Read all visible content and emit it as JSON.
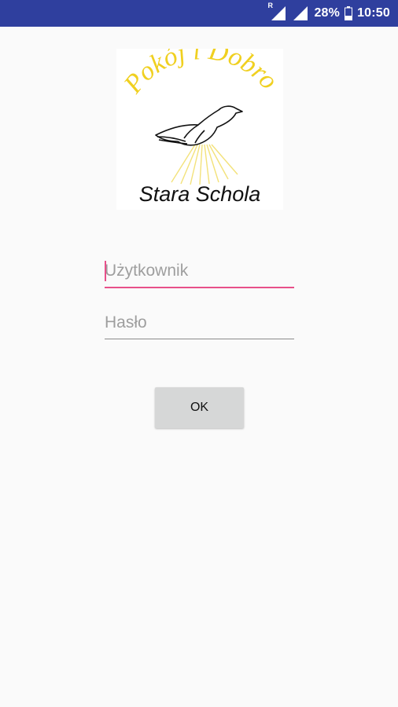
{
  "status_bar": {
    "roaming_indicator": "R",
    "battery_percent": "28%",
    "time": "10:50",
    "background_color": "#2f3f9e",
    "icons": [
      "signal-roaming-icon",
      "signal-icon",
      "battery-icon"
    ]
  },
  "logo": {
    "arc_text": "Pokój i Dobro",
    "name_text": "Stara Schola",
    "arc_color": "#f0d020",
    "icon": "dove-icon"
  },
  "form": {
    "username_placeholder": "Użytkownik",
    "password_placeholder": "Hasło",
    "ok_label": "OK",
    "accent_color": "#e8508a"
  }
}
